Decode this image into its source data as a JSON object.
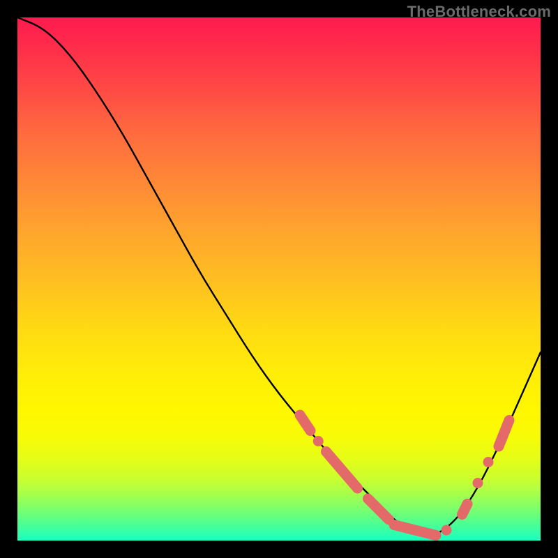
{
  "watermark": "TheBottleneck.com",
  "chart_data": {
    "type": "line",
    "title": "",
    "xlabel": "",
    "ylabel": "",
    "xlim": [
      0,
      100
    ],
    "ylim": [
      0,
      100
    ],
    "grid": false,
    "legend": false,
    "series": [
      {
        "name": "bottleneck-curve",
        "x": [
          0,
          5,
          10,
          15,
          20,
          25,
          30,
          35,
          40,
          45,
          50,
          55,
          60,
          65,
          70,
          72,
          75,
          78,
          80,
          84,
          88,
          92,
          96,
          100
        ],
        "y": [
          100,
          98,
          93,
          86,
          78,
          69,
          60,
          51,
          43,
          35,
          28,
          22,
          16,
          11,
          6,
          4,
          2,
          1,
          1,
          4,
          10,
          18,
          27,
          36
        ]
      }
    ],
    "markers": [
      {
        "type": "segment",
        "x0": 54,
        "y0": 24,
        "x1": 56,
        "y1": 21
      },
      {
        "type": "dot",
        "x": 57.5,
        "y": 19
      },
      {
        "type": "segment",
        "x0": 59,
        "y0": 17,
        "x1": 65,
        "y1": 10
      },
      {
        "type": "segment",
        "x0": 67,
        "y0": 8,
        "x1": 71,
        "y1": 4
      },
      {
        "type": "segment",
        "x0": 72,
        "y0": 3,
        "x1": 80,
        "y1": 1
      },
      {
        "type": "dot",
        "x": 82,
        "y": 2
      },
      {
        "type": "segment",
        "x0": 85,
        "y0": 5,
        "x1": 86,
        "y1": 7
      },
      {
        "type": "dot",
        "x": 88,
        "y": 11
      },
      {
        "type": "dot",
        "x": 90,
        "y": 15
      },
      {
        "type": "segment",
        "x0": 92,
        "y0": 18,
        "x1": 94,
        "y1": 23
      }
    ],
    "background_gradient": {
      "top": "#ff1a4f",
      "mid": "#ffed08",
      "bottom": "#19ffc2"
    }
  }
}
